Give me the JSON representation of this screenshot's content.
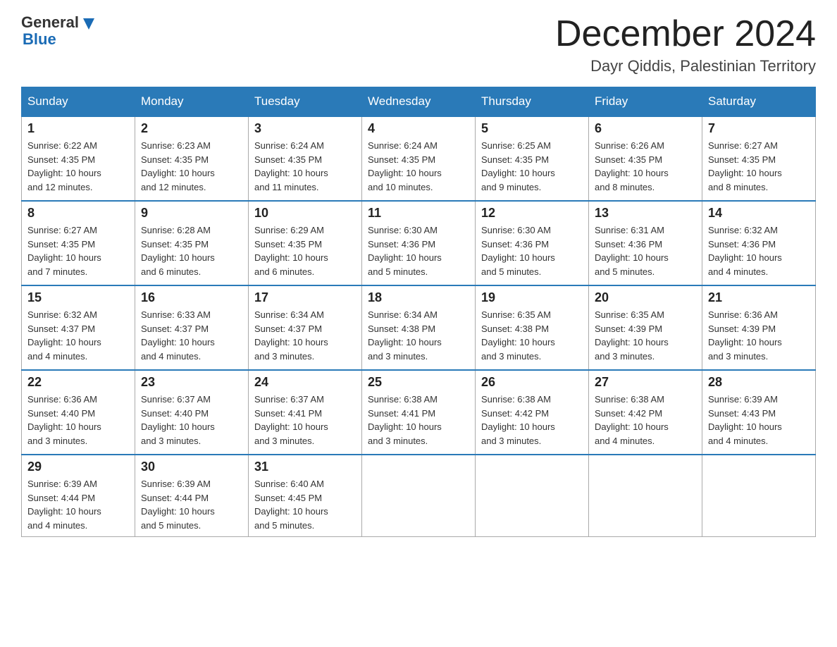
{
  "header": {
    "logo": {
      "general": "General",
      "blue": "Blue"
    },
    "title": "December 2024",
    "location": "Dayr Qiddis, Palestinian Territory"
  },
  "weekdays": [
    "Sunday",
    "Monday",
    "Tuesday",
    "Wednesday",
    "Thursday",
    "Friday",
    "Saturday"
  ],
  "weeks": [
    [
      {
        "day": "1",
        "sunrise": "6:22 AM",
        "sunset": "4:35 PM",
        "daylight": "10 hours and 12 minutes."
      },
      {
        "day": "2",
        "sunrise": "6:23 AM",
        "sunset": "4:35 PM",
        "daylight": "10 hours and 12 minutes."
      },
      {
        "day": "3",
        "sunrise": "6:24 AM",
        "sunset": "4:35 PM",
        "daylight": "10 hours and 11 minutes."
      },
      {
        "day": "4",
        "sunrise": "6:24 AM",
        "sunset": "4:35 PM",
        "daylight": "10 hours and 10 minutes."
      },
      {
        "day": "5",
        "sunrise": "6:25 AM",
        "sunset": "4:35 PM",
        "daylight": "10 hours and 9 minutes."
      },
      {
        "day": "6",
        "sunrise": "6:26 AM",
        "sunset": "4:35 PM",
        "daylight": "10 hours and 8 minutes."
      },
      {
        "day": "7",
        "sunrise": "6:27 AM",
        "sunset": "4:35 PM",
        "daylight": "10 hours and 8 minutes."
      }
    ],
    [
      {
        "day": "8",
        "sunrise": "6:27 AM",
        "sunset": "4:35 PM",
        "daylight": "10 hours and 7 minutes."
      },
      {
        "day": "9",
        "sunrise": "6:28 AM",
        "sunset": "4:35 PM",
        "daylight": "10 hours and 6 minutes."
      },
      {
        "day": "10",
        "sunrise": "6:29 AM",
        "sunset": "4:35 PM",
        "daylight": "10 hours and 6 minutes."
      },
      {
        "day": "11",
        "sunrise": "6:30 AM",
        "sunset": "4:36 PM",
        "daylight": "10 hours and 5 minutes."
      },
      {
        "day": "12",
        "sunrise": "6:30 AM",
        "sunset": "4:36 PM",
        "daylight": "10 hours and 5 minutes."
      },
      {
        "day": "13",
        "sunrise": "6:31 AM",
        "sunset": "4:36 PM",
        "daylight": "10 hours and 5 minutes."
      },
      {
        "day": "14",
        "sunrise": "6:32 AM",
        "sunset": "4:36 PM",
        "daylight": "10 hours and 4 minutes."
      }
    ],
    [
      {
        "day": "15",
        "sunrise": "6:32 AM",
        "sunset": "4:37 PM",
        "daylight": "10 hours and 4 minutes."
      },
      {
        "day": "16",
        "sunrise": "6:33 AM",
        "sunset": "4:37 PM",
        "daylight": "10 hours and 4 minutes."
      },
      {
        "day": "17",
        "sunrise": "6:34 AM",
        "sunset": "4:37 PM",
        "daylight": "10 hours and 3 minutes."
      },
      {
        "day": "18",
        "sunrise": "6:34 AM",
        "sunset": "4:38 PM",
        "daylight": "10 hours and 3 minutes."
      },
      {
        "day": "19",
        "sunrise": "6:35 AM",
        "sunset": "4:38 PM",
        "daylight": "10 hours and 3 minutes."
      },
      {
        "day": "20",
        "sunrise": "6:35 AM",
        "sunset": "4:39 PM",
        "daylight": "10 hours and 3 minutes."
      },
      {
        "day": "21",
        "sunrise": "6:36 AM",
        "sunset": "4:39 PM",
        "daylight": "10 hours and 3 minutes."
      }
    ],
    [
      {
        "day": "22",
        "sunrise": "6:36 AM",
        "sunset": "4:40 PM",
        "daylight": "10 hours and 3 minutes."
      },
      {
        "day": "23",
        "sunrise": "6:37 AM",
        "sunset": "4:40 PM",
        "daylight": "10 hours and 3 minutes."
      },
      {
        "day": "24",
        "sunrise": "6:37 AM",
        "sunset": "4:41 PM",
        "daylight": "10 hours and 3 minutes."
      },
      {
        "day": "25",
        "sunrise": "6:38 AM",
        "sunset": "4:41 PM",
        "daylight": "10 hours and 3 minutes."
      },
      {
        "day": "26",
        "sunrise": "6:38 AM",
        "sunset": "4:42 PM",
        "daylight": "10 hours and 3 minutes."
      },
      {
        "day": "27",
        "sunrise": "6:38 AM",
        "sunset": "4:42 PM",
        "daylight": "10 hours and 4 minutes."
      },
      {
        "day": "28",
        "sunrise": "6:39 AM",
        "sunset": "4:43 PM",
        "daylight": "10 hours and 4 minutes."
      }
    ],
    [
      {
        "day": "29",
        "sunrise": "6:39 AM",
        "sunset": "4:44 PM",
        "daylight": "10 hours and 4 minutes."
      },
      {
        "day": "30",
        "sunrise": "6:39 AM",
        "sunset": "4:44 PM",
        "daylight": "10 hours and 5 minutes."
      },
      {
        "day": "31",
        "sunrise": "6:40 AM",
        "sunset": "4:45 PM",
        "daylight": "10 hours and 5 minutes."
      },
      null,
      null,
      null,
      null
    ]
  ],
  "labels": {
    "sunrise": "Sunrise:",
    "sunset": "Sunset:",
    "daylight": "Daylight:"
  }
}
